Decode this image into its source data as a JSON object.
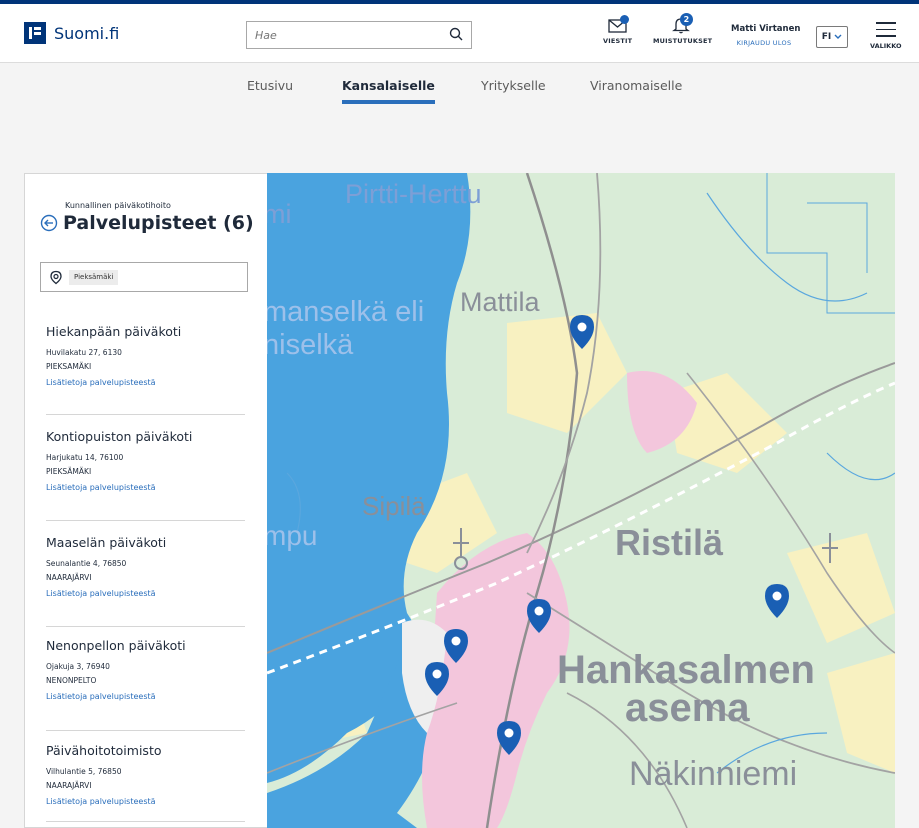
{
  "header": {
    "logo_text": "Suomi.fi",
    "search_placeholder": "Hae",
    "messages_label": "VIESTIT",
    "reminders_label": "MUISTUTUKSET",
    "reminders_count": "2",
    "user_name": "Matti Virtanen",
    "logout_label": "KIRJAUDU ULOS",
    "language": "FI",
    "menu_label": "VALIKKO"
  },
  "nav": {
    "tabs": [
      {
        "label": "Etusivu",
        "active": false
      },
      {
        "label": "Kansalaiselle",
        "active": true
      },
      {
        "label": "Yritykselle",
        "active": false
      },
      {
        "label": "Viranomaiselle",
        "active": false
      }
    ]
  },
  "panel": {
    "subtitle": "Kunnallinen päiväkotihoito",
    "title": "Palvelupisteet (6)",
    "location_chip": "Pieksämäki",
    "items": [
      {
        "name": "Hiekanpään päiväkoti",
        "street": "Huvilakatu 27, 6130",
        "city": "PIEKSAMÄKI",
        "link": "Lisätietoja palvelupisteestä"
      },
      {
        "name": "Kontiopuiston päiväkoti",
        "street": "Harjukatu 14, 76100",
        "city": "PIEKSÄMÄKI",
        "link": "Lisätietoja palvelupisteestä"
      },
      {
        "name": "Maaselän päiväkoti",
        "street": "Seunalantie 4, 76850",
        "city": "NAARAJÄRVI",
        "link": "Lisätietoja palvelupisteestä"
      },
      {
        "name": "Nenonpellon päiväkoti",
        "street": "Ojakuja 3, 76940",
        "city": "NENONPELTO",
        "link": "Lisätietoja palvelupisteestä"
      },
      {
        "name": "Päivähoitotoimisto",
        "street": "Vilhulantie 5, 76850",
        "city": "NAARAJÄRVI",
        "link": "Lisätietoja palvelupisteestä"
      }
    ]
  },
  "map": {
    "place_labels": [
      "Pirtti-Herttu",
      "mi",
      "manselkä eli",
      "niselkä",
      "Mattila",
      "Sipilä",
      "mpu",
      "Ristilä",
      "Hankasalmen",
      "asema",
      "Näkinniemi"
    ],
    "marker_color": "#1a5fb4",
    "marker_count": 6
  },
  "colors": {
    "brand": "#003479",
    "accent": "#2a6ebb",
    "water": "#4aa3df",
    "urban": "#f3c6dc"
  }
}
